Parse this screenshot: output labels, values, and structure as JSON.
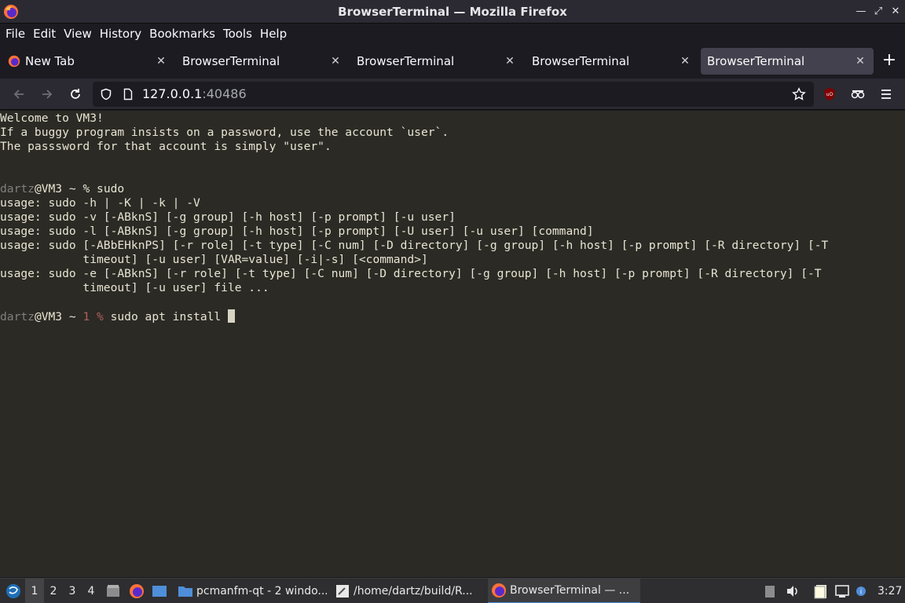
{
  "window": {
    "title": "BrowserTerminal — Mozilla Firefox"
  },
  "menu": [
    "File",
    "Edit",
    "View",
    "History",
    "Bookmarks",
    "Tools",
    "Help"
  ],
  "tabs": [
    {
      "label": "New Tab"
    },
    {
      "label": "BrowserTerminal"
    },
    {
      "label": "BrowserTerminal"
    },
    {
      "label": "BrowserTerminal"
    },
    {
      "label": "BrowserTerminal"
    }
  ],
  "url": {
    "host": "127.0.0.1",
    "port": ":40486"
  },
  "terminal": {
    "welcome": [
      "Welcome to VM3!",
      "If a buggy program insists on a password, use the account `user`.",
      "The passsword for that account is simply \"user\"."
    ],
    "prompt1": {
      "user": "dartz",
      "host": "@VM3 ~ ",
      "symbol": "% ",
      "command": "sudo"
    },
    "output": [
      "usage: sudo -h | -K | -k | -V",
      "usage: sudo -v [-ABknS] [-g group] [-h host] [-p prompt] [-u user]",
      "usage: sudo -l [-ABknS] [-g group] [-h host] [-p prompt] [-U user] [-u user] [command]",
      "usage: sudo [-ABbEHknPS] [-r role] [-t type] [-C num] [-D directory] [-g group] [-h host] [-p prompt] [-R directory] [-T",
      "            timeout] [-u user] [VAR=value] [-i|-s] [<command>]",
      "usage: sudo -e [-ABknS] [-r role] [-t type] [-C num] [-D directory] [-g group] [-h host] [-p prompt] [-R directory] [-T",
      "            timeout] [-u user] file ..."
    ],
    "prompt2": {
      "user": "dartz",
      "host": "@VM3 ~ ",
      "status": "1 % ",
      "command": "sudo apt install "
    }
  },
  "taskbar": {
    "workspaces": [
      "1",
      "2",
      "3",
      "4"
    ],
    "tasks": [
      {
        "label": "pcmanfm-qt - 2 windo..."
      },
      {
        "label": "/home/dartz/build/R..."
      },
      {
        "label": "BrowserTerminal — ..."
      }
    ],
    "clock": "3:27"
  },
  "colors": {
    "accent": "#4f8ed8",
    "terminal_bg": "#2b2a24",
    "ublock": "#800000"
  }
}
